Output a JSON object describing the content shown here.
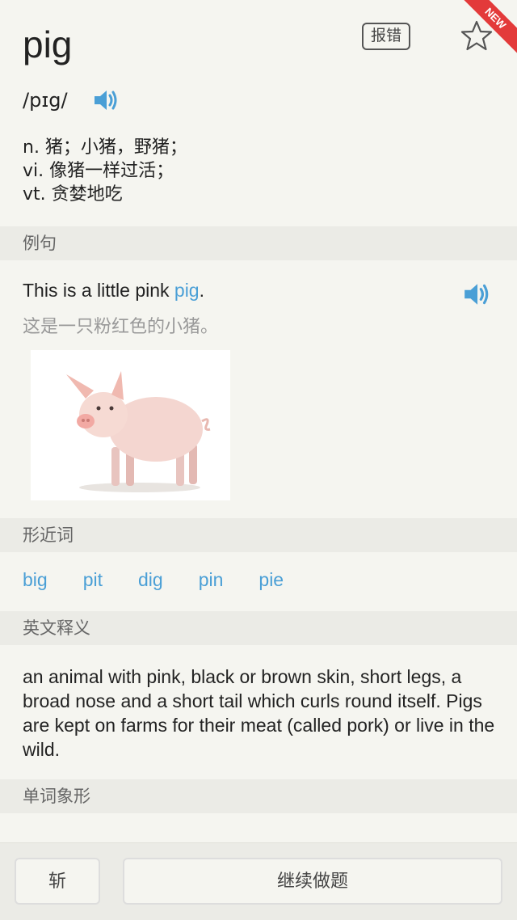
{
  "corner_badge": "NEW",
  "word": "pig",
  "report_label": "报错",
  "phonetic": "/pɪg/",
  "definitions": [
    "n. 猪；小猪，野猪；",
    "vi. 像猪一样过活；",
    "vt. 贪婪地吃"
  ],
  "sections": {
    "examples": "例句",
    "similar": "形近词",
    "english_def": "英文释义",
    "pictograph": "单词象形"
  },
  "example": {
    "before": "This is a little pink ",
    "highlight": "pig",
    "after": ".",
    "translation": "这是一只粉红色的小猪。"
  },
  "similar_words": [
    "big",
    "pit",
    "dig",
    "pin",
    "pie"
  ],
  "english_definition": "an animal with pink, black or brown skin, short legs, a broad nose and a short tail which curls round itself. Pigs are kept on farms for their meat (called pork) or live in the wild.",
  "bottom": {
    "cut_label": "斩",
    "continue_label": "继续做题"
  },
  "colors": {
    "accent": "#4a9fd6",
    "ribbon": "#e33a3a"
  }
}
